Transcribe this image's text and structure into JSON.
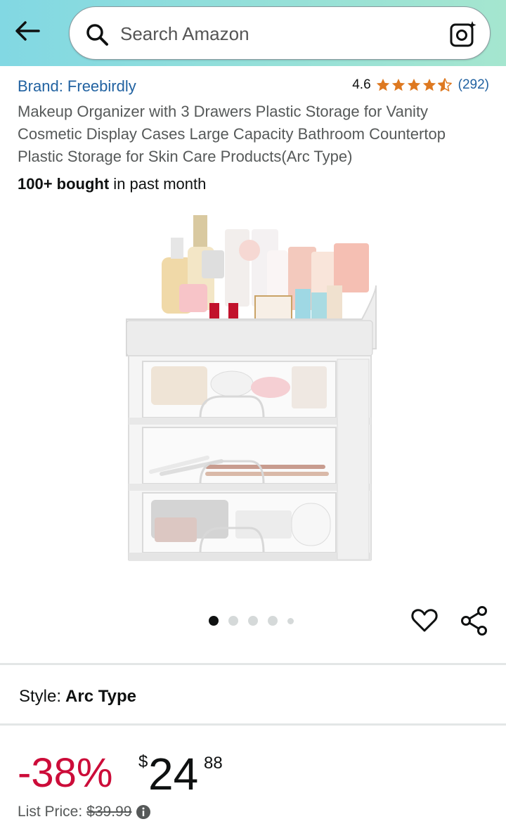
{
  "colors": {
    "header_gradient_start": "#82d8e3",
    "header_gradient_end": "#a5e6cf",
    "link_blue": "#2162a1",
    "star_orange": "#de7921",
    "discount_red": "#cc0c39"
  },
  "header": {
    "back_icon": "arrow-left-icon",
    "search_placeholder": "Search Amazon",
    "search_icon": "search-icon",
    "camera_icon": "camera-lens-icon"
  },
  "product": {
    "brand": "Brand: Freebirdly",
    "rating": "4.6",
    "rating_stars": 4.6,
    "review_count": "(292)",
    "title": "Makeup Organizer with 3 Drawers Plastic Storage for Vanity Cosmetic Display Cases Large Capacity Bathroom Countertop Plastic Storage for Skin Care Products(Arc Type)",
    "bought_bold": "100+ bought",
    "bought_rest": " in past month",
    "image_count": 5,
    "active_image": 1
  },
  "style": {
    "label": "Style:",
    "value": "Arc Type"
  },
  "price": {
    "discount": "-38%",
    "currency": "$",
    "whole": "24",
    "fraction": "88",
    "list_price_label": "List Price:",
    "list_price_value": "$39.99"
  }
}
